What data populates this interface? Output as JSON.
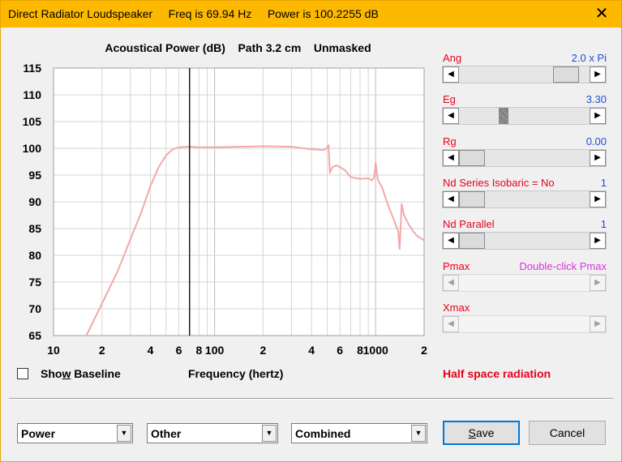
{
  "window": {
    "title": "Direct Radiator Loudspeaker     Freq is 69.94 Hz     Power is 100.2255 dB",
    "close_glyph": "✕"
  },
  "plot": {
    "title": "Acoustical Power (dB)    Path 3.2 cm    Unmasked"
  },
  "chart_data": {
    "type": "line",
    "title": "Acoustical Power (dB)    Path 3.2 cm    Unmasked",
    "xlabel": "Frequency (hertz)",
    "ylabel": "",
    "x_scale": "log",
    "xlim": [
      10,
      2000
    ],
    "ylim": [
      65,
      115
    ],
    "grid": true,
    "x_ticks": [
      {
        "value": 10,
        "label": "10"
      },
      {
        "value": 20,
        "label": "2"
      },
      {
        "value": 40,
        "label": "4"
      },
      {
        "value": 60,
        "label": "6"
      },
      {
        "value": 80,
        "label": "8"
      },
      {
        "value": 100,
        "label": "100"
      },
      {
        "value": 200,
        "label": "2"
      },
      {
        "value": 400,
        "label": "4"
      },
      {
        "value": 600,
        "label": "6"
      },
      {
        "value": 800,
        "label": "8"
      },
      {
        "value": 1000,
        "label": "1000"
      },
      {
        "value": 2000,
        "label": "2"
      }
    ],
    "y_ticks": [
      65,
      70,
      75,
      80,
      85,
      90,
      95,
      100,
      105,
      110,
      115
    ],
    "marker_x": 69.94,
    "series": [
      {
        "color": "#f4a8a8",
        "x": [
          16,
          20,
          25,
          30,
          35,
          40,
          45,
          50,
          55,
          60,
          70,
          80,
          100,
          150,
          200,
          300,
          400,
          480,
          500,
          510,
          520,
          540,
          570,
          600,
          650,
          700,
          800,
          900,
          950,
          980,
          1000,
          1030,
          1100,
          1200,
          1300,
          1380,
          1410,
          1450,
          1500,
          1600,
          1700,
          1800,
          2000
        ],
        "y": [
          65,
          71,
          77,
          83,
          88,
          93,
          96.5,
          98.7,
          99.8,
          100.2,
          100.3,
          100.2,
          100.2,
          100.3,
          100.4,
          100.3,
          99.8,
          99.7,
          100.1,
          100.6,
          95.4,
          96.5,
          96.8,
          96.5,
          95.8,
          94.6,
          94.3,
          94.4,
          94.0,
          94.6,
          97.3,
          94.2,
          92.6,
          89.2,
          86.6,
          84.5,
          81.2,
          89.6,
          87.5,
          85.8,
          84.6,
          83.7,
          82.8
        ]
      }
    ]
  },
  "show_baseline": {
    "label_pre": "Sho",
    "label_underlined": "w",
    "label_post": " Baseline",
    "checked": false
  },
  "halfspace_text": "Half space radiation",
  "controls": [
    {
      "label": "Ang",
      "value": "2.0 x Pi",
      "thumb_fraction": 0.9,
      "thumb_style": "plain",
      "enabled": true
    },
    {
      "label": "Eg",
      "value": "3.30",
      "thumb_fraction": 0.33,
      "thumb_style": "hatched",
      "enabled": true
    },
    {
      "label": "Rg",
      "value": "0.00",
      "thumb_fraction": 0.0,
      "thumb_style": "plain",
      "enabled": true
    },
    {
      "label": "Nd Series   Isobaric = No",
      "value": "1",
      "thumb_fraction": 0.0,
      "thumb_style": "plain",
      "enabled": true
    },
    {
      "label": "Nd  Parallel",
      "value": "1",
      "thumb_fraction": 0.0,
      "thumb_style": "plain",
      "enabled": true
    },
    {
      "label": "Pmax",
      "value": "Double-click Pmax",
      "thumb_fraction": null,
      "thumb_style": "none",
      "enabled": false
    },
    {
      "label": "Xmax",
      "value": "",
      "thumb_fraction": null,
      "thumb_style": "none",
      "enabled": false
    }
  ],
  "arrows": {
    "left": "◀",
    "right": "▶",
    "drop": "▼"
  },
  "combos": {
    "mode": "Power",
    "secondary": "Other",
    "combination": "Combined"
  },
  "buttons": {
    "save_pre": "",
    "save_underlined": "S",
    "save_post": "ave",
    "cancel": "Cancel"
  }
}
